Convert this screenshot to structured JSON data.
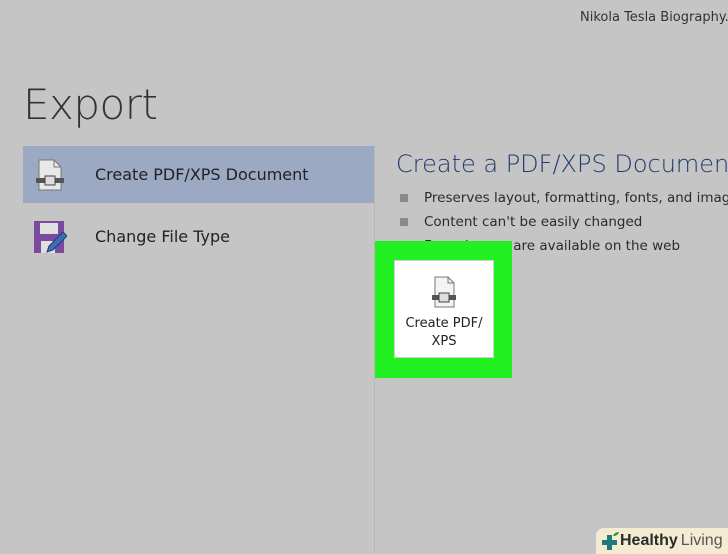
{
  "document_title": "Nikola Tesla Biography.docx",
  "page_title": "Export",
  "nav": [
    {
      "label": "Create PDF/XPS Document",
      "icon": "pdf-document-icon",
      "selected": true
    },
    {
      "label": "Change File Type",
      "icon": "save-edit-icon",
      "selected": false
    }
  ],
  "main": {
    "title": "Create a PDF/XPS Document",
    "bullets": [
      "Preserves layout, formatting, fonts, and images",
      "Content can't be easily changed",
      "Free viewers are available on the web"
    ],
    "button_label": "Create PDF/ XPS"
  },
  "watermark": {
    "word1": "Healthy",
    "word2": "Living"
  },
  "colors": {
    "background": "#c5c5c5",
    "selected": "#9ba9c3",
    "highlight": "#21f021",
    "title": "#1f3a6e"
  }
}
